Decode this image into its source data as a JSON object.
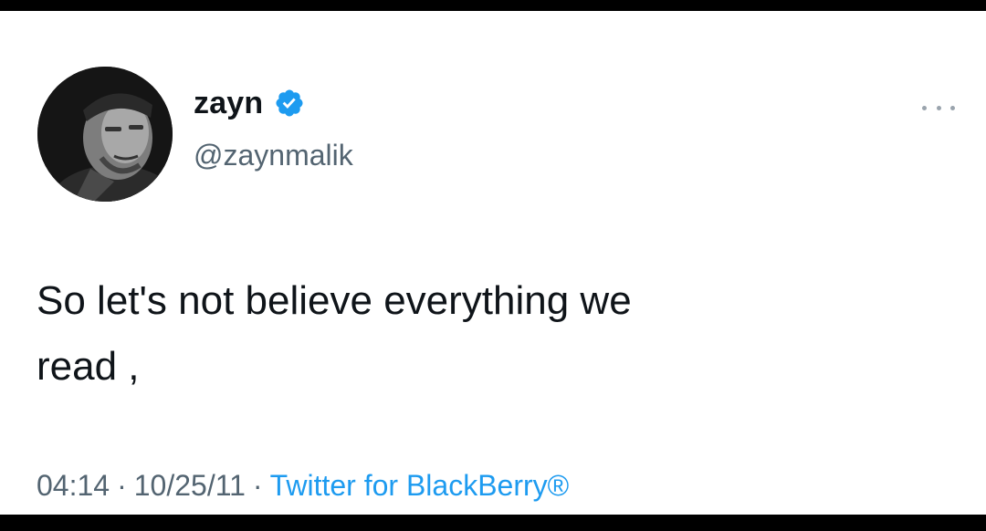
{
  "tweet": {
    "author": {
      "display_name": "zayn",
      "handle": "@zaynmalik",
      "verified": true,
      "avatar_icon": "profile-photo"
    },
    "text": "So let's not believe everything we\nread ,",
    "meta": {
      "time": "04:14",
      "date": "10/25/11",
      "separator": "·",
      "source": "Twitter for BlackBerry®"
    },
    "menu_icon": "more-dots-icon"
  },
  "colors": {
    "text_primary": "#0f1419",
    "text_secondary": "#536471",
    "accent_blue": "#1d9bf0",
    "background": "#ffffff",
    "frame_border": "#000000"
  }
}
